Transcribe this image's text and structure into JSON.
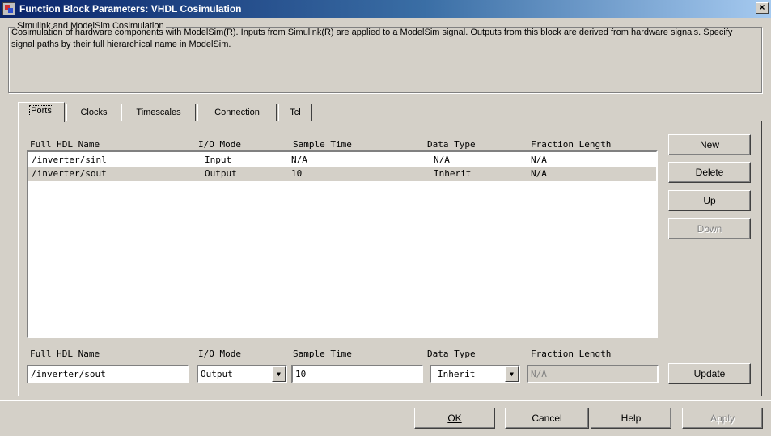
{
  "window": {
    "title": "Function Block Parameters: VHDL Cosimulation"
  },
  "group": {
    "title": "Simulink and ModelSim Cosimulation",
    "description": "Cosimulation of hardware components with ModelSim(R). Inputs from Simulink(R) are applied to a ModelSim signal. Outputs from this block are derived from hardware signals. Specify signal paths by their full hierarchical name in ModelSim."
  },
  "tabs": [
    {
      "label": "Ports",
      "active": true
    },
    {
      "label": "Clocks",
      "active": false
    },
    {
      "label": "Timescales",
      "active": false
    },
    {
      "label": "Connection",
      "active": false
    },
    {
      "label": "Tcl",
      "active": false
    }
  ],
  "ports": {
    "columns": [
      "Full HDL Name",
      "I/O Mode",
      "Sample Time",
      "Data Type",
      "Fraction Length"
    ],
    "rows": [
      {
        "name": "/inverter/sinl",
        "mode": "Input",
        "sample_time": "N/A",
        "data_type": "N/A",
        "fraction_length": "N/A",
        "selected": false
      },
      {
        "name": "/inverter/sout",
        "mode": "Output",
        "sample_time": "10",
        "data_type": "Inherit",
        "fraction_length": "N/A",
        "selected": true
      }
    ],
    "side_buttons": {
      "new": "New",
      "delete": "Delete",
      "up": "Up",
      "down": "Down"
    },
    "editor": {
      "name_value": "/inverter/sout",
      "mode_value": "Output",
      "sample_time_value": "10",
      "data_type_value": "Inherit",
      "fraction_length_value": "N/A",
      "update": "Update"
    }
  },
  "footer": {
    "ok": "OK",
    "cancel": "Cancel",
    "help": "Help",
    "apply": "Apply"
  },
  "colors": {
    "dialog_bg": "#d4d0c8",
    "title_gradient_start": "#0a246a",
    "title_gradient_end": "#a6caf0",
    "disabled_text": "#808080"
  }
}
